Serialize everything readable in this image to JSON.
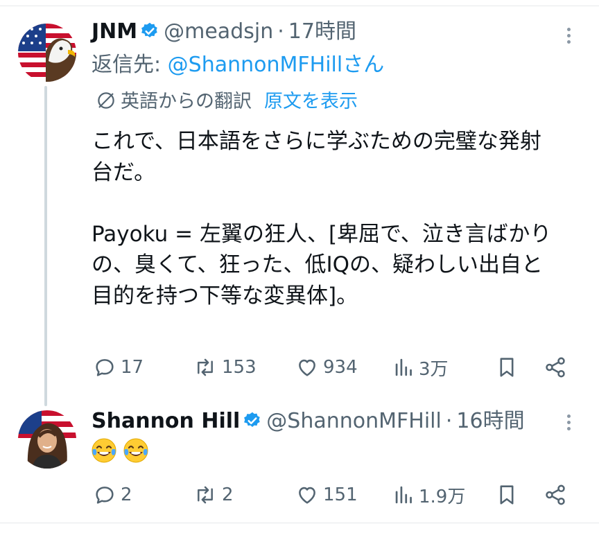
{
  "colors": {
    "accent": "#1d9bf0",
    "muted": "#536471",
    "text": "#0f1419",
    "verified": "#1d9bf0"
  },
  "tweet1": {
    "name": "JNM",
    "handle": "@meadsjn",
    "separator": "·",
    "time": "17時間",
    "reply_to_label": "返信先:",
    "reply_to_handle": "@ShannonMFHillさん",
    "translation_note": "英語からの翻訳",
    "show_original": "原文を表示",
    "lines": [
      "これで、日本語をさらに学ぶための完璧な発射",
      "台だ。",
      "",
      "Payoku = 左翼の狂人、[卑屈で、泣き言ばかり",
      "の、臭くて、狂った、低IQの、疑わしい出自と",
      "目的を持つ下等な変異体]。"
    ],
    "stats": {
      "replies": "17",
      "reposts": "153",
      "likes": "934",
      "views": "3万"
    },
    "icons": [
      "verified-badge-icon",
      "more-icon",
      "translate-icon",
      "reply-icon",
      "repost-icon",
      "like-icon",
      "views-icon",
      "bookmark-icon",
      "share-icon"
    ]
  },
  "tweet2": {
    "name": "Shannon Hill",
    "handle": "@ShannonMFHill",
    "separator": "·",
    "time": "16時間",
    "emojis": [
      "face-with-tears-of-joy",
      "face-with-tears-of-joy"
    ],
    "stats": {
      "replies": "2",
      "reposts": "2",
      "likes": "151",
      "views": "1.9万"
    }
  }
}
